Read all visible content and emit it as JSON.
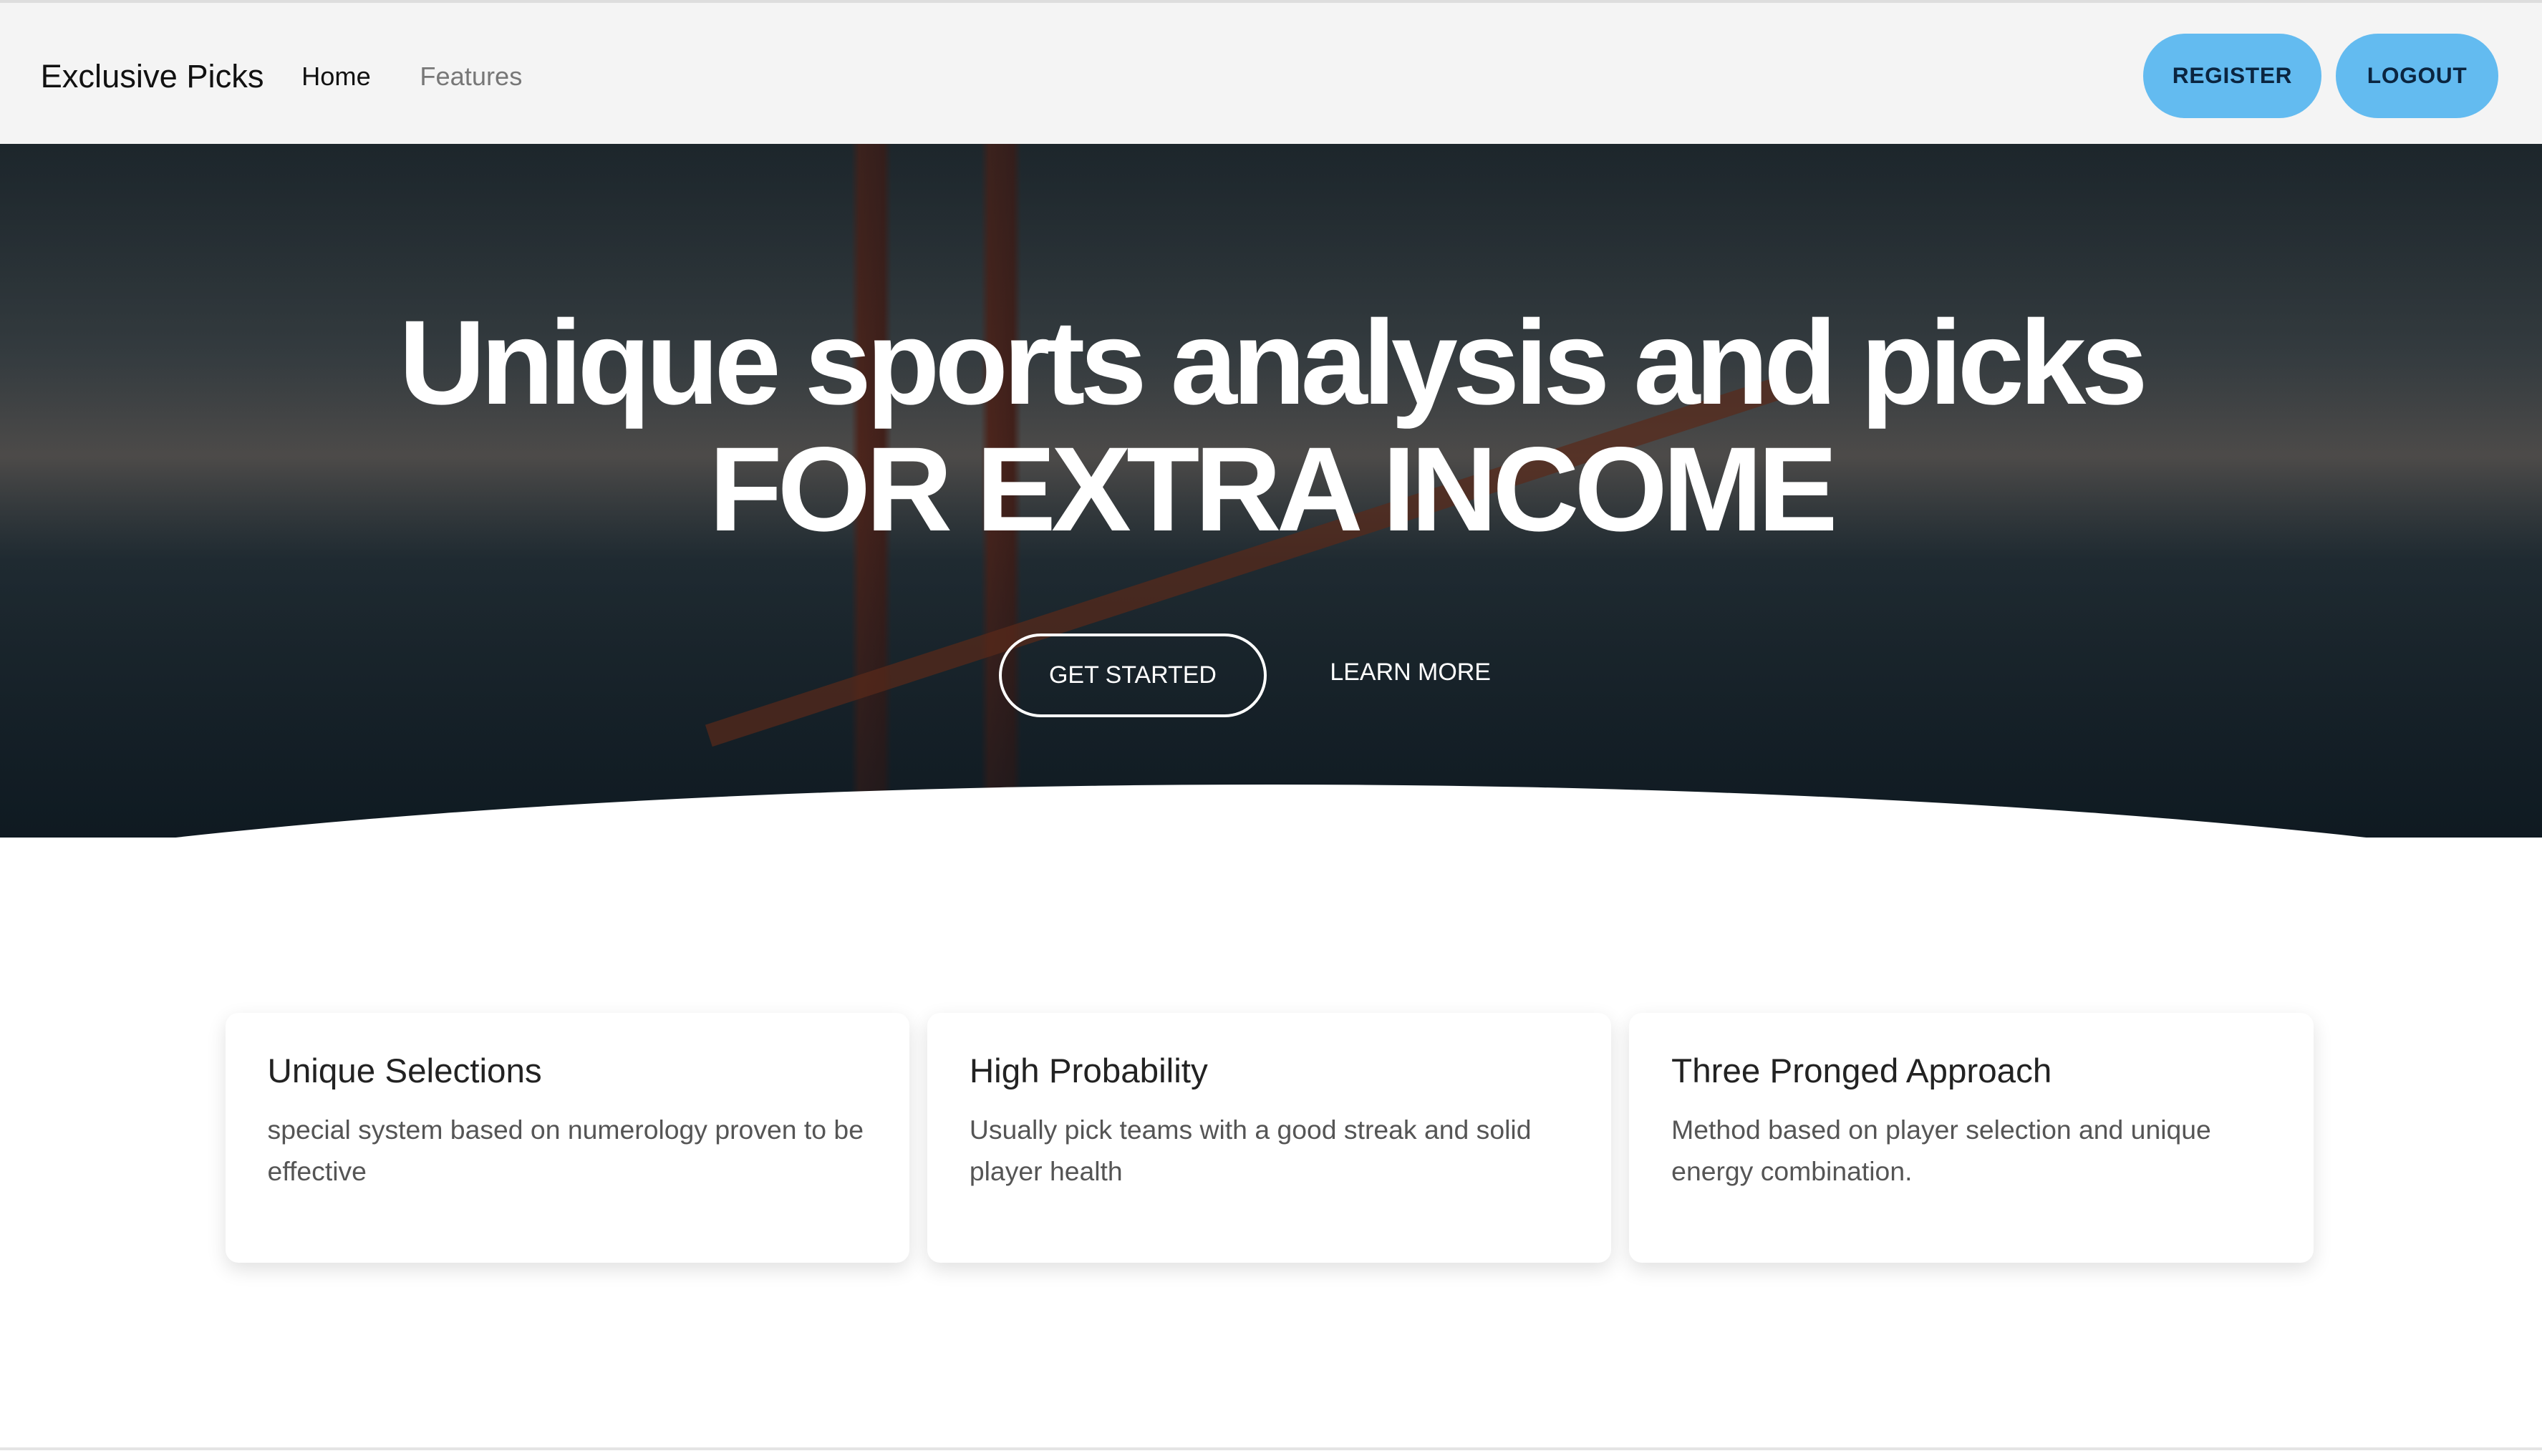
{
  "nav": {
    "brand": "Exclusive Picks",
    "links": [
      "Home",
      "Features"
    ],
    "register": "REGISTER",
    "logout": "LOGOUT"
  },
  "hero": {
    "line1": "Unique sports analysis and picks",
    "line2": "FOR EXTRA INCOME",
    "get_started": "GET STARTED",
    "learn_more": "LEARN MORE"
  },
  "cards": [
    {
      "title": "Unique Selections",
      "text": "special system based on numerology proven to be effective"
    },
    {
      "title": "High Probability",
      "text": "Usually pick teams with a good streak and solid player health"
    },
    {
      "title": "Three Pronged Approach",
      "text": "Method based on player selection and unique energy combination."
    }
  ],
  "colors": {
    "accent": "#63bbf0"
  }
}
